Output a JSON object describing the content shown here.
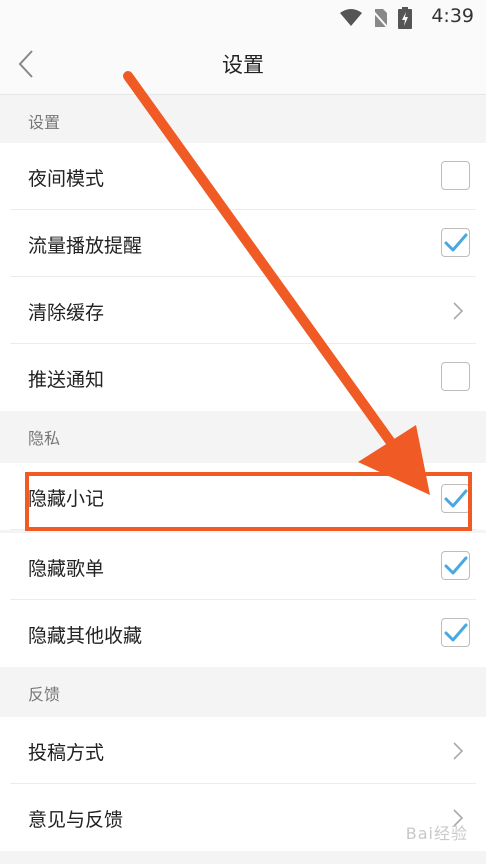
{
  "status_bar": {
    "time": "4:39"
  },
  "header": {
    "title": "设置",
    "back_icon": "chevron-left-icon"
  },
  "sections": [
    {
      "title": "设置",
      "items": [
        {
          "label": "夜间模式",
          "control": "checkbox",
          "checked": false
        },
        {
          "label": "流量播放提醒",
          "control": "checkbox",
          "checked": true
        },
        {
          "label": "清除缓存",
          "control": "chevron"
        },
        {
          "label": "推送通知",
          "control": "checkbox",
          "checked": false
        }
      ]
    },
    {
      "title": "隐私",
      "items": [
        {
          "label": "隐藏小记",
          "control": "checkbox",
          "checked": true
        },
        {
          "label": "隐藏歌单",
          "control": "checkbox",
          "checked": true
        },
        {
          "label": "隐藏其他收藏",
          "control": "checkbox",
          "checked": true
        }
      ]
    },
    {
      "title": "反馈",
      "items": [
        {
          "label": "投稿方式",
          "control": "chevron"
        },
        {
          "label": "意见与反馈",
          "control": "chevron"
        }
      ]
    }
  ],
  "watermark": "Bai经验",
  "colors": {
    "check": "#4aa8e0",
    "annotation": "#f05a24",
    "background": "#f4f4f4"
  }
}
